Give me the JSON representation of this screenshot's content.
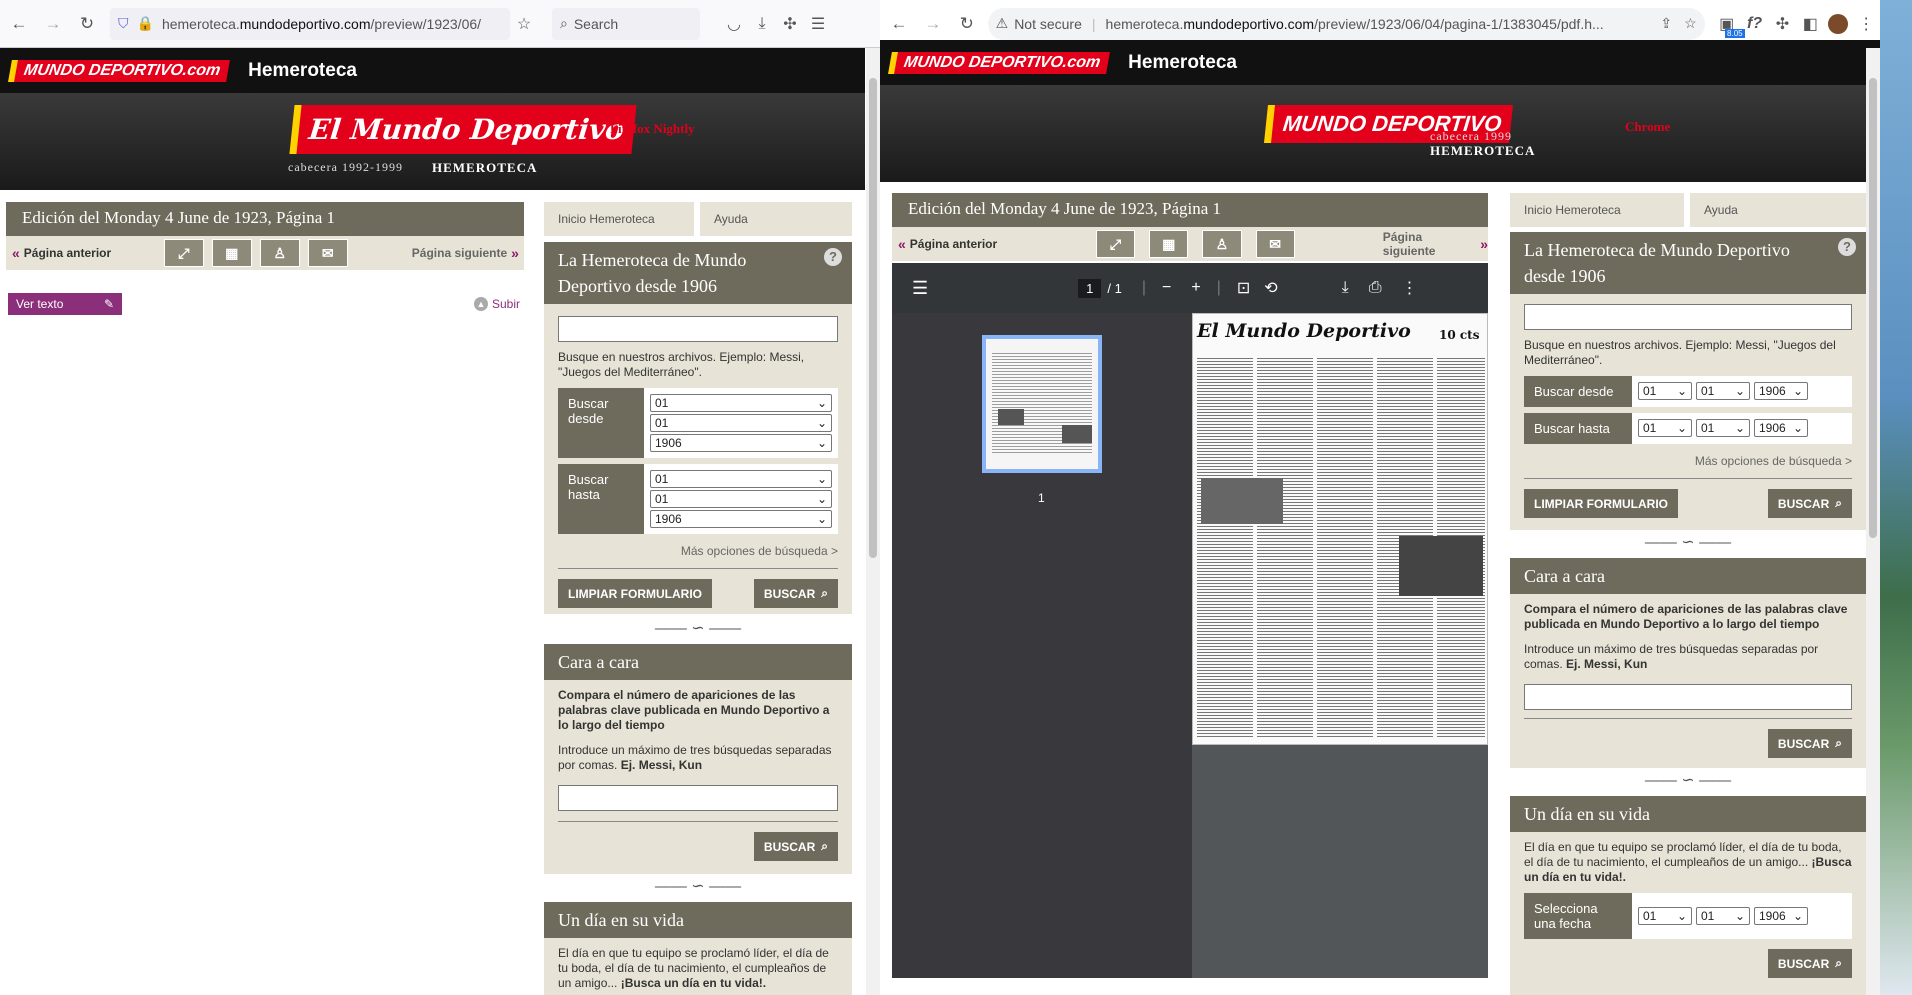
{
  "firefox": {
    "url_prefix": "hemeroteca.",
    "url_domain": "mundodeportivo.com",
    "url_path": "/preview/1923/06/",
    "search_placeholder": "Search",
    "tag": "Firefox Nightly"
  },
  "chrome": {
    "not_secure": "Not secure",
    "url_prefix": "hemeroteca.",
    "url_domain": "mundodeportivo.com",
    "url_path": "/preview/1923/06/04/pagina-1/1383045/pdf.h...",
    "ext_badge": "8.05",
    "fq": "f?",
    "tag": "Chrome"
  },
  "site": {
    "logo_small": "MUNDO DEPORTIVO.com",
    "title": "Hemeroteca",
    "ff_logo": "El Mundo Deportivo",
    "ff_cabecera": "cabecera 1992-1999",
    "cr_logo": "MUNDO DEPORTIVO",
    "cr_cabecera": "cabecera 1999",
    "hemeroteca": "HEMEROTECA"
  },
  "edition": {
    "title": "Edición del Monday 4 June de 1923, Página 1",
    "prev": "Página anterior",
    "next": "Página siguiente",
    "ver_texto": "Ver texto",
    "subir": "Subir"
  },
  "sidebar": {
    "tab_inicio": "Inicio Hemeroteca",
    "tab_ayuda": "Ayuda",
    "search_title": "La Hemeroteca de Mundo Deportivo desde 1906",
    "help": "?",
    "search_hint": "Busque en nuestros archivos. Ejemplo: Messi, \"Juegos del Mediterráneo\".",
    "buscar_desde": "Buscar desde",
    "buscar_hasta": "Buscar hasta",
    "day": "01",
    "month": "01",
    "year": "1906",
    "mas_opciones": "Más opciones de búsqueda >",
    "limpiar": "LIMPIAR FORMULARIO",
    "buscar": "BUSCAR",
    "cara_title": "Cara a cara",
    "cara_desc": "Compara el número de apariciones de las palabras clave publicada en Mundo Deportivo a lo largo del tiempo",
    "cara_hint_a": "Introduce un máximo de tres búsquedas separadas por comas.",
    "cara_hint_b": "Ej. Messi, Kun",
    "dia_title": "Un día en su vida",
    "dia_desc": "El día en que tu equipo se proclamó líder, el día de tu boda, el día de tu nacimiento, el cumpleaños de un amigo...",
    "dia_cta": "¡Busca un día en tu vida!.",
    "selecciona": "Selecciona una fecha"
  },
  "pdf": {
    "page": "1",
    "of": "/ 1",
    "thumb_label": "1",
    "paper_title": "El Mundo Deportivo",
    "paper_price": "10 cts"
  }
}
